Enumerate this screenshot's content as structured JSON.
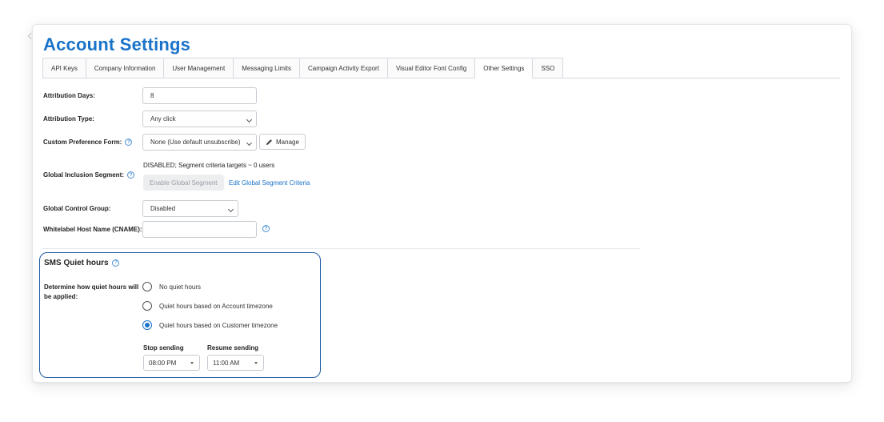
{
  "page": {
    "title": "Account Settings"
  },
  "tabs": [
    {
      "label": "API Keys",
      "active": false
    },
    {
      "label": "Company Information",
      "active": false
    },
    {
      "label": "User Management",
      "active": false
    },
    {
      "label": "Messaging Limits",
      "active": false
    },
    {
      "label": "Campaign Activity Export",
      "active": false
    },
    {
      "label": "Visual Editor Font Config",
      "active": false
    },
    {
      "label": "Other Settings",
      "active": true
    },
    {
      "label": "SSO",
      "active": false
    }
  ],
  "settings": {
    "attribution_days": {
      "label": "Attribution Days:",
      "value": "8"
    },
    "attribution_type": {
      "label": "Attribution Type:",
      "value": "Any click"
    },
    "custom_preference_form": {
      "label": "Custom Preference Form:",
      "value": "None (Use default unsubscribe)",
      "manage_label": "Manage"
    },
    "global_inclusion_segment": {
      "label": "Global Inclusion Segment:",
      "status": "DISABLED; Segment criteria targets ~ 0 users",
      "enable_label": "Enable Global Segment",
      "edit_label": "Edit Global Segment Criteria"
    },
    "global_control_group": {
      "label": "Global Control Group:",
      "value": "Disabled"
    },
    "whitelabel_host": {
      "label": "Whitelabel Host Name (CNAME):",
      "value": ""
    }
  },
  "sms_quiet_hours": {
    "title": "SMS Quiet hours",
    "description": "Determine how quiet hours will be applied:",
    "options": [
      {
        "label": "No quiet hours",
        "checked": false
      },
      {
        "label": "Quiet hours based on Account timezone",
        "checked": false
      },
      {
        "label": "Quiet hours based on Customer timezone",
        "checked": true
      }
    ],
    "stop_sending": {
      "label": "Stop sending",
      "value": "08:00 PM"
    },
    "resume_sending": {
      "label": "Resume sending",
      "value": "11:00 AM"
    }
  },
  "colors": {
    "accent": "#1a73c9",
    "highlight_border": "#1e5aa6"
  }
}
